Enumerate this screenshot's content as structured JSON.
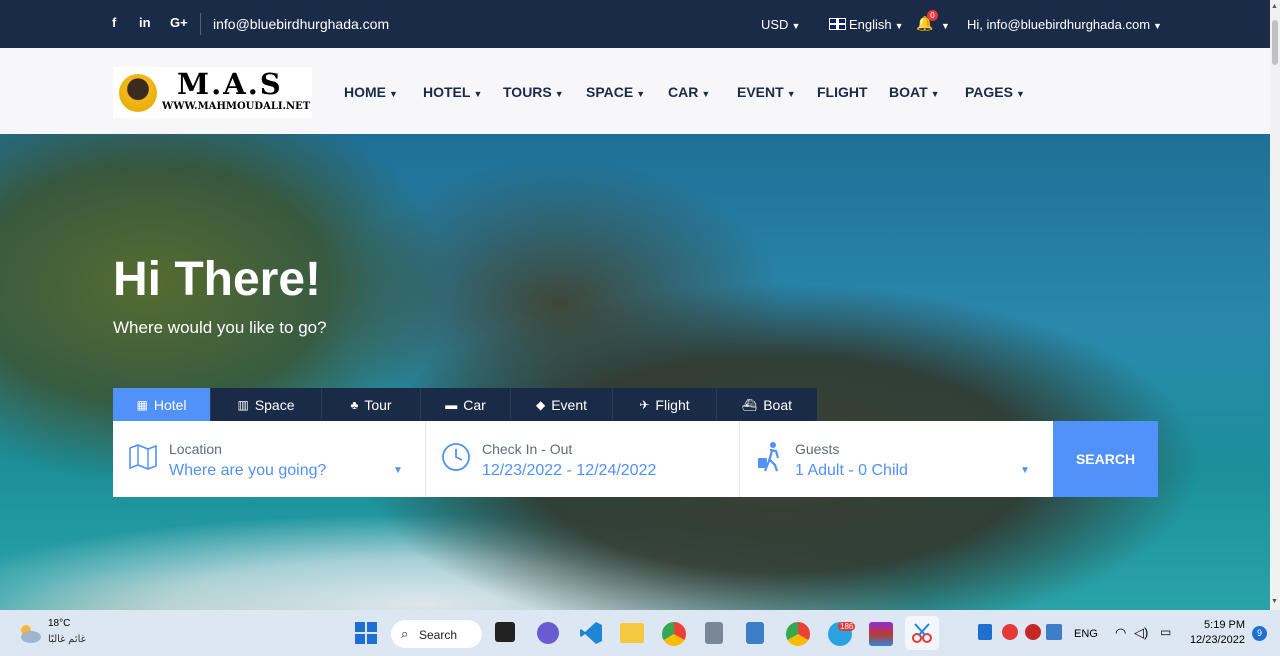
{
  "topbar": {
    "social": [
      "f",
      "in",
      "G+"
    ],
    "email": "info@bluebirdhurghada.com",
    "currency": "USD",
    "language": "English",
    "notifications_count": "0",
    "user_greeting": "Hi, info@bluebirdhurghada.com"
  },
  "logo": {
    "title": "M.A.S",
    "site": "WWW.MAHMOUDALI.NET"
  },
  "menu": [
    "HOME",
    "HOTEL",
    "TOURS",
    "SPACE",
    "CAR",
    "EVENT",
    "FLIGHT",
    "BOAT",
    "PAGES"
  ],
  "hero": {
    "title": "Hi There!",
    "subtitle": "Where would you like to go?"
  },
  "tabs": [
    "Hotel",
    "Space",
    "Tour",
    "Car",
    "Event",
    "Flight",
    "Boat"
  ],
  "search": {
    "location_label": "Location",
    "location_value": "Where are you going?",
    "checkin_label": "Check In - Out",
    "checkin_value": "12/23/2022 - 12/24/2022",
    "guests_label": "Guests",
    "guests_value": "1 Adult - 0 Child",
    "button": "SEARCH"
  },
  "taskbar": {
    "temperature": "18°C",
    "weather": "غائم غالبًا",
    "search": "Search",
    "telegram_badge": "186",
    "lang": "ENG",
    "time": "5:19 PM",
    "date": "12/23/2022",
    "notification_count": "9"
  },
  "colors": {
    "navy": "#1a2b48",
    "accent": "#5191fa"
  }
}
